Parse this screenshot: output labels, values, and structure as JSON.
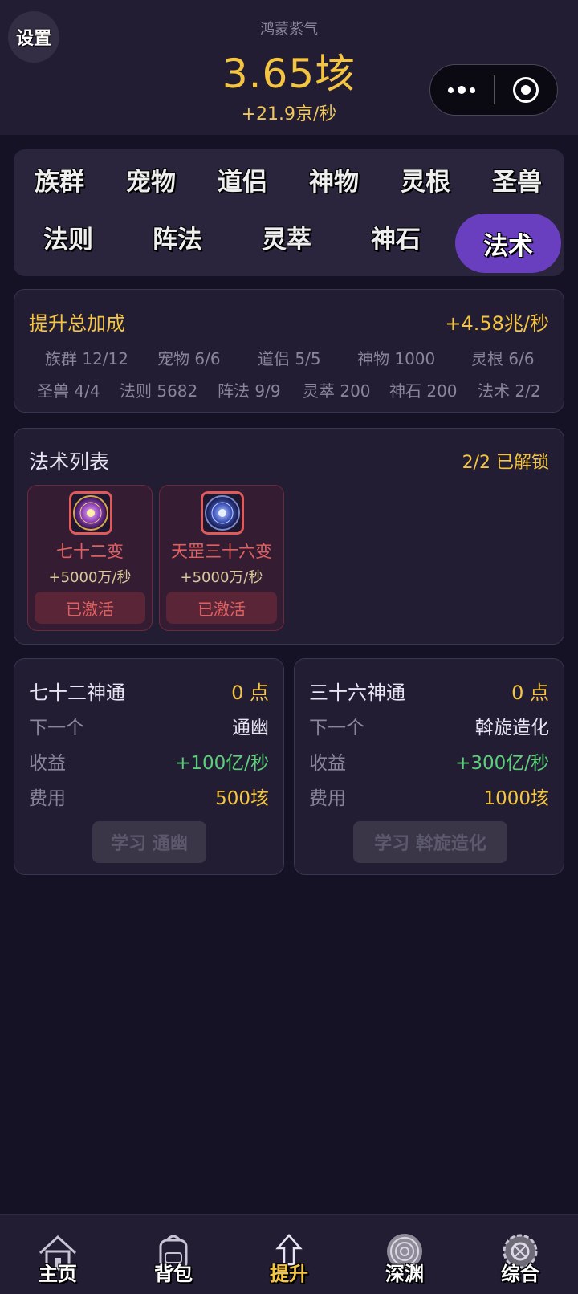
{
  "header": {
    "settings_label": "设置",
    "resource_name": "鸿蒙紫气",
    "resource_value": "3.65垓",
    "resource_rate": "+21.9京/秒"
  },
  "tabs": [
    {
      "label": "族群",
      "active": false
    },
    {
      "label": "宠物",
      "active": false
    },
    {
      "label": "道侣",
      "active": false
    },
    {
      "label": "神物",
      "active": false
    },
    {
      "label": "灵根",
      "active": false
    },
    {
      "label": "圣兽",
      "active": false
    },
    {
      "label": "法则",
      "active": false
    },
    {
      "label": "阵法",
      "active": false
    },
    {
      "label": "灵萃",
      "active": false
    },
    {
      "label": "神石",
      "active": false
    },
    {
      "label": "法术",
      "active": true
    }
  ],
  "bonus": {
    "title": "提升总加成",
    "total": "+4.58兆/秒",
    "stats": [
      "族群 12/12",
      "宠物 6/6",
      "道侣 5/5",
      "神物 1000",
      "灵根 6/6",
      "圣兽 4/4",
      "法则 5682",
      "阵法 9/9",
      "灵萃 200",
      "神石 200",
      "法术 2/2"
    ]
  },
  "spell_list": {
    "title": "法术列表",
    "count": "2/2 已解锁",
    "items": [
      {
        "name": "七十二变",
        "rate": "+5000万/秒",
        "status": "已激活",
        "icon": "spell-72-icon"
      },
      {
        "name": "天罡三十六变",
        "rate": "+5000万/秒",
        "status": "已激活",
        "icon": "spell-36-icon"
      }
    ]
  },
  "skills": [
    {
      "title": "七十二神通",
      "points": "0 点",
      "next_label": "下一个",
      "next_value": "通幽",
      "income_label": "收益",
      "income_value": "+100亿/秒",
      "cost_label": "费用",
      "cost_value": "500垓",
      "button": "学习 通幽"
    },
    {
      "title": "三十六神通",
      "points": "0 点",
      "next_label": "下一个",
      "next_value": "斡旋造化",
      "income_label": "收益",
      "income_value": "+300亿/秒",
      "cost_label": "费用",
      "cost_value": "1000垓",
      "button": "学习 斡旋造化"
    }
  ],
  "nav": [
    {
      "label": "主页",
      "icon": "house-icon",
      "active": false
    },
    {
      "label": "背包",
      "icon": "backpack-icon",
      "active": false
    },
    {
      "label": "提升",
      "icon": "arrow-up-icon",
      "active": true
    },
    {
      "label": "深渊",
      "icon": "vortex-icon",
      "active": false
    },
    {
      "label": "综合",
      "icon": "gear-icon",
      "active": false
    }
  ],
  "colors": {
    "accent_gold": "#f5c542",
    "active_tab": "#6a3fbf",
    "income_green": "#5ccf7a",
    "spell_red": "#e06060"
  }
}
